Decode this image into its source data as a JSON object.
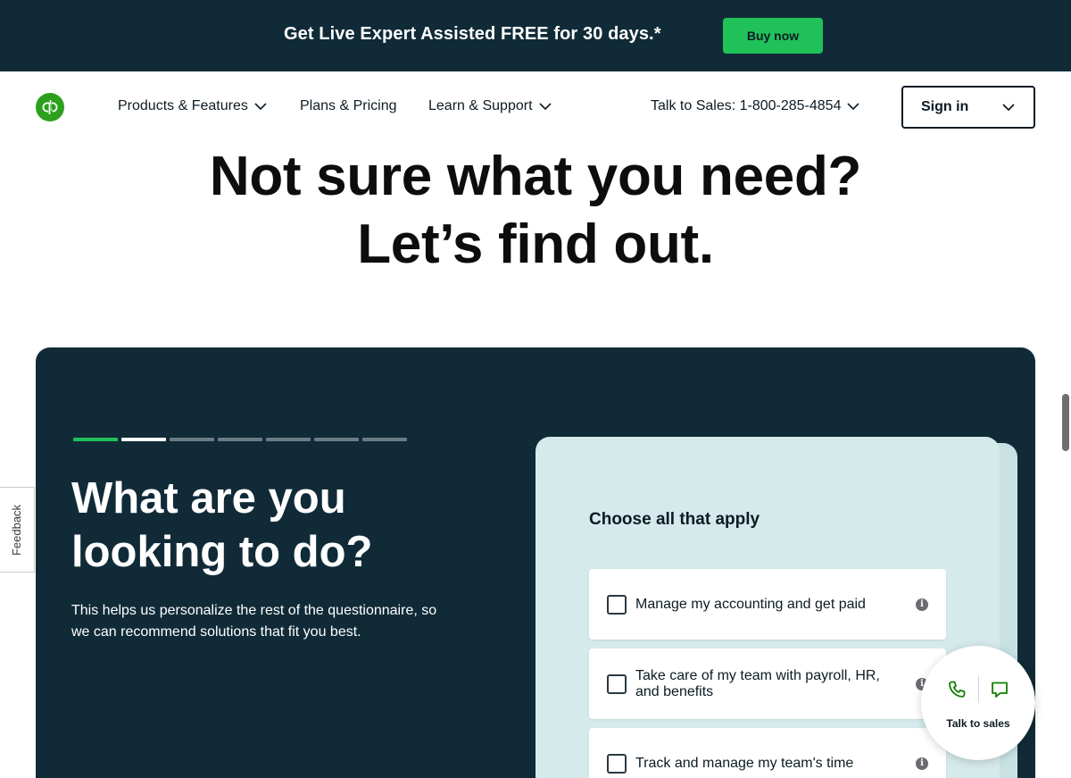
{
  "promo": {
    "text": "Get Live Expert Assisted FREE for 30 days.*",
    "button_label": "Buy now"
  },
  "nav": {
    "items": [
      {
        "label": "Products & Features",
        "has_dropdown": true
      },
      {
        "label": "Plans & Pricing",
        "has_dropdown": false
      },
      {
        "label": "Learn & Support",
        "has_dropdown": true
      }
    ],
    "sales_phone": "Talk to Sales: 1-800-285-4854",
    "signin_label": "Sign in"
  },
  "hero": {
    "line1": "Not sure what you need?",
    "line2": "Let’s find out."
  },
  "questionnaire": {
    "progress": {
      "total_steps": 7,
      "completed": 1,
      "current": 2
    },
    "title": "What are you looking to do?",
    "subtitle": "This helps us personalize the rest of the questionnaire, so we can recommend solutions that fit you best.",
    "card_heading": "Choose all that apply",
    "options": [
      {
        "label": "Manage my accounting and get paid",
        "checked": false
      },
      {
        "label": "Take care of my team with payroll, HR, and benefits",
        "checked": false
      },
      {
        "label": "Track and manage my team's time",
        "checked": false
      }
    ]
  },
  "feedback_label": "Feedback",
  "talk_to_sales": {
    "label": "Talk to sales"
  },
  "colors": {
    "brand_dark": "#102b37",
    "accent_green": "#21c15a",
    "logo_green": "#2ca01c",
    "card_bg": "#d5eaeb"
  },
  "icons": {
    "logo": "quickbooks-logo",
    "chevron": "chevron-down-icon",
    "info": "info-icon",
    "phone": "phone-icon",
    "chat": "chat-icon"
  }
}
